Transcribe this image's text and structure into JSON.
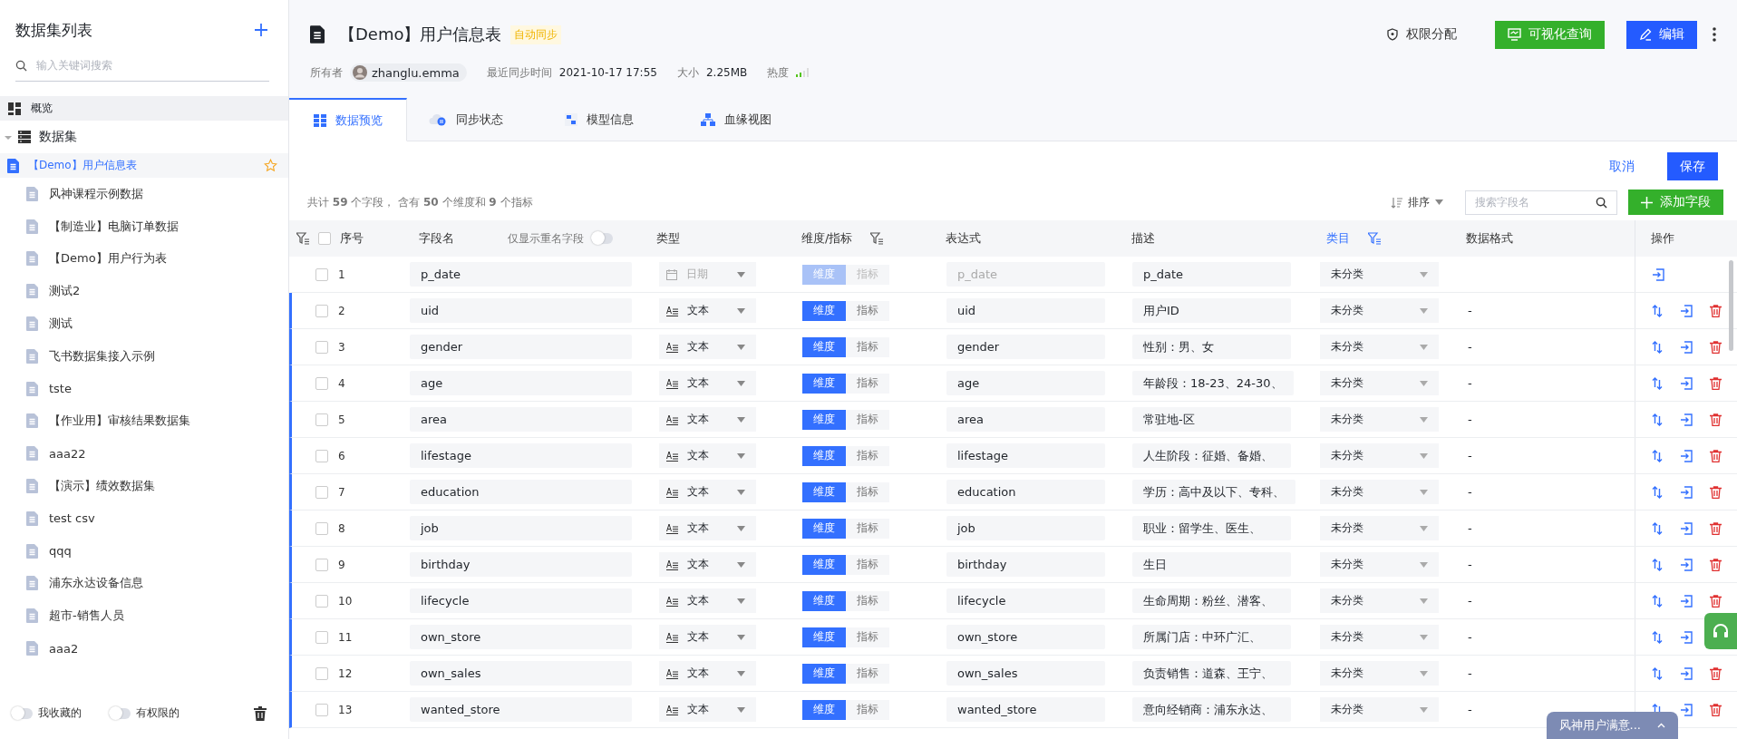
{
  "sidebar": {
    "title": "数据集列表",
    "search": {
      "placeholder": "输入关键词搜索"
    },
    "nav": [
      {
        "label": "概览",
        "kind": "overview",
        "selected": true
      },
      {
        "label": "数据集",
        "kind": "datasets",
        "selected": false,
        "expanded": true,
        "children": [
          {
            "label": "【Demo】用户信息表",
            "selected": true,
            "starred": true
          },
          {
            "label": "风神课程示例数据",
            "selected": false,
            "starred": false
          },
          {
            "label": "【制造业】电脑订单数据",
            "selected": false,
            "starred": false
          },
          {
            "label": "【Demo】用户行为表",
            "selected": false,
            "starred": false
          },
          {
            "label": "测试2",
            "selected": false,
            "starred": false
          },
          {
            "label": "测试",
            "selected": false,
            "starred": false
          },
          {
            "label": "飞书数据集接入示例",
            "selected": false,
            "starred": false
          },
          {
            "label": "tste",
            "selected": false,
            "starred": false
          },
          {
            "label": "【作业用】审核结果数据集",
            "selected": false,
            "starred": false
          },
          {
            "label": "aaa22",
            "selected": false,
            "starred": false
          },
          {
            "label": "【演示】绩效数据集",
            "selected": false,
            "starred": false
          },
          {
            "label": "test csv",
            "selected": false,
            "starred": false
          },
          {
            "label": "qqq",
            "selected": false,
            "starred": false
          },
          {
            "label": "浦东永达设备信息",
            "selected": false,
            "starred": false
          },
          {
            "label": "超市-销售人员",
            "selected": false,
            "starred": false
          },
          {
            "label": "aaa2",
            "selected": false,
            "starred": false
          }
        ]
      }
    ],
    "filters": [
      {
        "label": "我收藏的",
        "on": false
      },
      {
        "label": "有权限的",
        "on": false
      }
    ]
  },
  "header": {
    "title": "【Demo】用户信息表",
    "badge": "自动同步",
    "actions": [
      {
        "label": "权限分配",
        "kind": "plain"
      },
      {
        "label": "可视化查询",
        "kind": "green"
      },
      {
        "label": "编辑",
        "kind": "primary"
      }
    ],
    "meta": [
      {
        "label": "所有者",
        "value": "zhanglu.emma",
        "kind": "user"
      },
      {
        "label": "最近同步时间",
        "value": "2021-10-17 17:55",
        "kind": "text"
      },
      {
        "label": "大小",
        "value": "2.25MB",
        "kind": "text"
      },
      {
        "label": "热度",
        "kind": "heat"
      }
    ]
  },
  "tabs": [
    {
      "label": "数据预览",
      "selected": true
    },
    {
      "label": "同步状态",
      "selected": false
    },
    {
      "label": "模型信息",
      "selected": false
    },
    {
      "label": "血缘视图",
      "selected": false
    }
  ],
  "edit_actions": {
    "cancel": "取消",
    "save": "保存"
  },
  "summary": "共计 **59** 个字段， 含有 **50** 个维度和 **9** 个指标",
  "toolbar": {
    "sort": "排序",
    "search_placeholder": "搜索字段名",
    "add": "添加字段"
  },
  "table": {
    "all_checked": false,
    "columns": [
      {
        "label": "序号",
        "filter": true,
        "active": false
      },
      {
        "label": "字段名",
        "filter": false,
        "active": false,
        "toggle": {
          "label": "仅显示重名字段",
          "on": false
        }
      },
      {
        "label": "类型",
        "filter": false,
        "active": false
      },
      {
        "label": "维度/指标",
        "filter": true,
        "active": false
      },
      {
        "label": "表达式",
        "filter": false,
        "active": false
      },
      {
        "label": "描述",
        "filter": false,
        "active": false
      },
      {
        "label": "类目",
        "filter": true,
        "active": true
      },
      {
        "label": "数据格式",
        "filter": false,
        "active": false
      },
      {
        "label": "操作",
        "filter": false,
        "active": false
      }
    ],
    "rows": [
      {
        "index": "1",
        "checked": false,
        "name": "p_date",
        "type": "日期",
        "kind": "date",
        "dimension": true,
        "dim_label": "维度",
        "metric_label": "指标",
        "expression": "p_date",
        "description": "p_date",
        "category": "未分类",
        "locked": true,
        "modified": false
      },
      {
        "index": "2",
        "checked": false,
        "name": "uid",
        "type": "文本",
        "kind": "text",
        "dimension": true,
        "dim_label": "维度",
        "metric_label": "指标",
        "expression": "uid",
        "description": "用户ID",
        "category": "未分类",
        "format": "-",
        "locked": false,
        "modified": true
      },
      {
        "index": "3",
        "checked": false,
        "name": "gender",
        "type": "文本",
        "kind": "text",
        "dimension": true,
        "dim_label": "维度",
        "metric_label": "指标",
        "expression": "gender",
        "description": "性别：男、女",
        "category": "未分类",
        "format": "-",
        "locked": false,
        "modified": true
      },
      {
        "index": "4",
        "checked": false,
        "name": "age",
        "type": "文本",
        "kind": "text",
        "dimension": true,
        "dim_label": "维度",
        "metric_label": "指标",
        "expression": "age",
        "description": "年龄段：18-23、24-30、",
        "category": "未分类",
        "format": "-",
        "locked": false,
        "modified": true
      },
      {
        "index": "5",
        "checked": false,
        "name": "area",
        "type": "文本",
        "kind": "text",
        "dimension": true,
        "dim_label": "维度",
        "metric_label": "指标",
        "expression": "area",
        "description": "常驻地-区",
        "category": "未分类",
        "format": "-",
        "locked": false,
        "modified": true
      },
      {
        "index": "6",
        "checked": false,
        "name": "lifestage",
        "type": "文本",
        "kind": "text",
        "dimension": true,
        "dim_label": "维度",
        "metric_label": "指标",
        "expression": "lifestage",
        "description": "人生阶段：征婚、备婚、",
        "category": "未分类",
        "format": "-",
        "locked": false,
        "modified": true
      },
      {
        "index": "7",
        "checked": false,
        "name": "education",
        "type": "文本",
        "kind": "text",
        "dimension": true,
        "dim_label": "维度",
        "metric_label": "指标",
        "expression": "education",
        "description": "学历：高中及以下、专科、",
        "category": "未分类",
        "format": "-",
        "locked": false,
        "modified": true
      },
      {
        "index": "8",
        "checked": false,
        "name": "job",
        "type": "文本",
        "kind": "text",
        "dimension": true,
        "dim_label": "维度",
        "metric_label": "指标",
        "expression": "job",
        "description": "职业：留学生、医生、",
        "category": "未分类",
        "format": "-",
        "locked": false,
        "modified": true
      },
      {
        "index": "9",
        "checked": false,
        "name": "birthday",
        "type": "文本",
        "kind": "text",
        "dimension": true,
        "dim_label": "维度",
        "metric_label": "指标",
        "expression": "birthday",
        "description": "生日",
        "category": "未分类",
        "format": "-",
        "locked": false,
        "modified": true
      },
      {
        "index": "10",
        "checked": false,
        "name": "lifecycle",
        "type": "文本",
        "kind": "text",
        "dimension": true,
        "dim_label": "维度",
        "metric_label": "指标",
        "expression": "lifecycle",
        "description": "生命周期：粉丝、潜客、",
        "category": "未分类",
        "format": "-",
        "locked": false,
        "modified": true
      },
      {
        "index": "11",
        "checked": false,
        "name": "own_store",
        "type": "文本",
        "kind": "text",
        "dimension": true,
        "dim_label": "维度",
        "metric_label": "指标",
        "expression": "own_store",
        "description": "所属门店：中环广汇、",
        "category": "未分类",
        "format": "-",
        "locked": false,
        "modified": true
      },
      {
        "index": "12",
        "checked": false,
        "name": "own_sales",
        "type": "文本",
        "kind": "text",
        "dimension": true,
        "dim_label": "维度",
        "metric_label": "指标",
        "expression": "own_sales",
        "description": "负责销售：道森、王宁、",
        "category": "未分类",
        "format": "-",
        "locked": false,
        "modified": true
      },
      {
        "index": "13",
        "checked": false,
        "name": "wanted_store",
        "type": "文本",
        "kind": "text",
        "dimension": true,
        "dim_label": "维度",
        "metric_label": "指标",
        "expression": "wanted_store",
        "description": "意向经销商：浦东永达、",
        "category": "未分类",
        "format": "-",
        "locked": false,
        "modified": true
      }
    ]
  },
  "feedback": {
    "label": "风神用户满意..."
  }
}
